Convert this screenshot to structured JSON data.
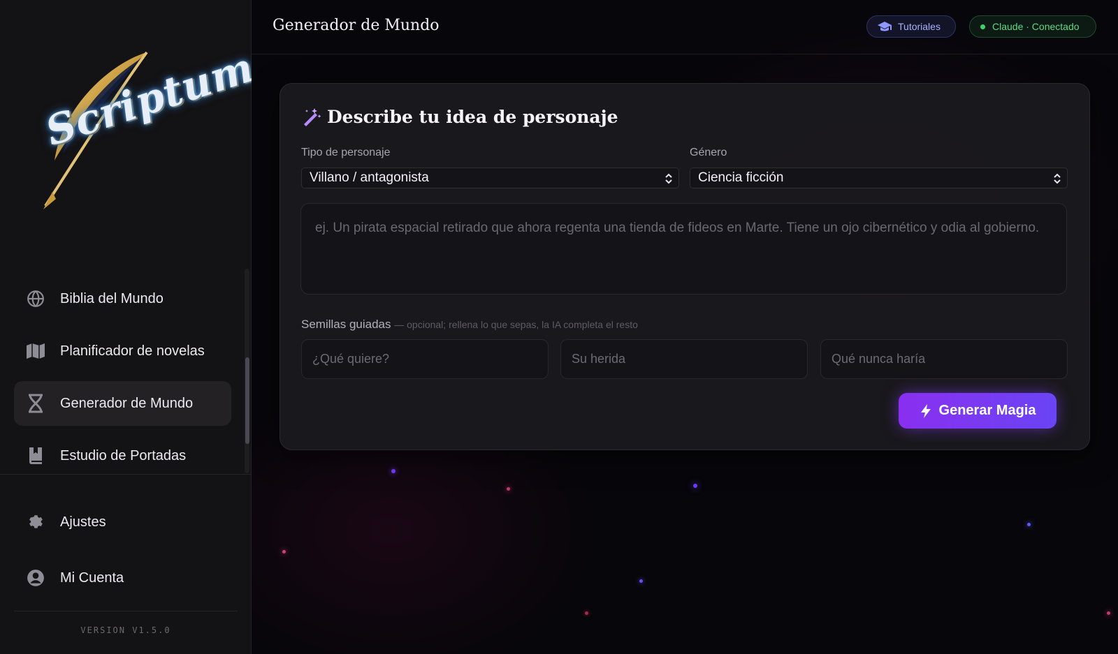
{
  "sidebar": {
    "logo_text": "Scriptum",
    "items": [
      {
        "label": "Biblia del Mundo",
        "icon": "globe-icon"
      },
      {
        "label": "Planificador de novelas",
        "icon": "map-icon"
      },
      {
        "label": "Generador de Mundo",
        "icon": "dna-icon",
        "active": true
      },
      {
        "label": "Estudio de Portadas",
        "icon": "book-icon"
      }
    ],
    "bottom_items": [
      {
        "label": "Ajustes",
        "icon": "gear-icon"
      },
      {
        "label": "Mi Cuenta",
        "icon": "user-circle-icon"
      }
    ],
    "version": "VERSION V1.5.0"
  },
  "header": {
    "title": "Generador de Mundo",
    "tutorials_label": "Tutoriales",
    "status_label": "Claude · Conectado"
  },
  "card": {
    "title": "Describe tu idea de personaje",
    "type_label": "Tipo de personaje",
    "type_value": "Villano / antagonista",
    "genre_label": "Género",
    "genre_value": "Ciencia ficción",
    "idea_placeholder": "ej. Un pirata espacial retirado que ahora regenta una tienda de fideos en Marte. Tiene un ojo cibernético y odia al gobierno.",
    "seeds_label": "Semillas guiadas",
    "seeds_hint": "— opcional; rellena lo que sepas, la IA completa el resto",
    "seed_placeholders": [
      "¿Qué quiere?",
      "Su herida",
      "Qué nunca haría"
    ],
    "generate_label": "Generar Magia"
  },
  "colors": {
    "accent": "#7c3aed",
    "status_green": "#39d36f",
    "tutorial_blue": "#a9b1ff"
  }
}
